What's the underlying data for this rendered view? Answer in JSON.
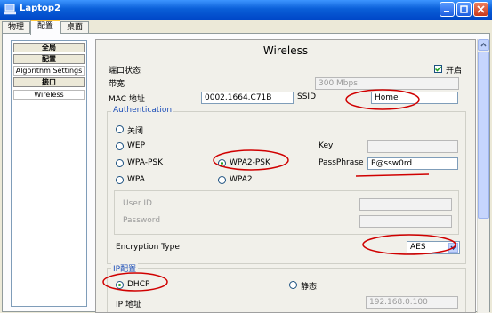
{
  "window": {
    "title": "Laptop2"
  },
  "tabs": [
    {
      "label": "物理",
      "active": false
    },
    {
      "label": "配置",
      "active": true
    },
    {
      "label": "桌面",
      "active": false
    }
  ],
  "sidebar": {
    "items": [
      {
        "label": "全局",
        "header": true
      },
      {
        "label": "配置",
        "header": true
      },
      {
        "label": "Algorithm Settings",
        "header": false
      },
      {
        "label": "接口",
        "header": true
      },
      {
        "label": "Wireless",
        "header": false
      }
    ]
  },
  "wireless": {
    "title": "Wireless",
    "port_status_label": "端口状态",
    "on_label": "开启",
    "on_checked": true,
    "bandwidth_label": "带宽",
    "bandwidth_value": "300 Mbps",
    "mac_label": "MAC 地址",
    "mac_value": "0002.1664.C71B",
    "ssid_label": "SSID",
    "ssid_value": "Home"
  },
  "auth": {
    "title": "Authentication",
    "options": [
      "关闭",
      "WEP",
      "WPA-PSK",
      "WPA2-PSK",
      "WPA",
      "WPA2"
    ],
    "selected": "WPA2-PSK",
    "key_label": "Key",
    "key_value": "",
    "passphrase_label": "PassPhrase",
    "passphrase_value": "P@ssw0rd",
    "userid_label": "User ID",
    "password_label": "Password",
    "encryption_label": "Encryption Type",
    "encryption_value": "AES"
  },
  "ip": {
    "title": "IP配置",
    "dhcp_label": "DHCP",
    "static_label": "静态",
    "mode": "DHCP",
    "address_label": "IP 地址",
    "address_value": "192.168.0.100"
  },
  "colors": {
    "annotation": "#d00000",
    "group_title": "#1e4fb8",
    "titlebar": "#0a5fd8"
  }
}
